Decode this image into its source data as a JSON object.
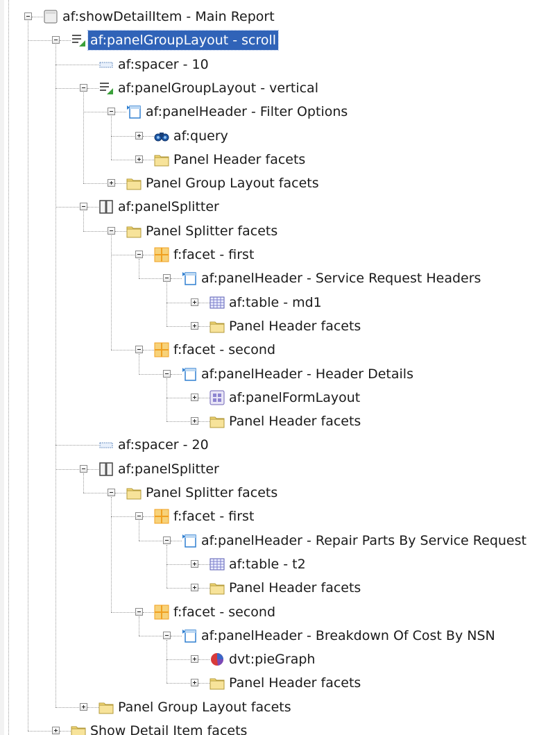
{
  "tree": {
    "nodes": [
      {
        "label": "af:showDetailItem - Main Report",
        "icon": "show-detail-item-icon",
        "depth": 0,
        "toggle": "minus"
      },
      {
        "label": "af:panelGroupLayout - scroll",
        "icon": "panel-group-layout-icon",
        "depth": 1,
        "toggle": "minus",
        "selected": true
      },
      {
        "label": "af:spacer - 10",
        "icon": "spacer-icon",
        "depth": 2,
        "toggle": "none"
      },
      {
        "label": "af:panelGroupLayout - vertical",
        "icon": "panel-group-layout-icon",
        "depth": 2,
        "toggle": "minus"
      },
      {
        "label": "af:panelHeader - Filter Options",
        "icon": "panel-header-icon",
        "depth": 3,
        "toggle": "minus"
      },
      {
        "label": "af:query",
        "icon": "binoculars-icon",
        "depth": 4,
        "toggle": "plus"
      },
      {
        "label": "Panel Header facets",
        "icon": "folder-icon",
        "depth": 4,
        "toggle": "plus"
      },
      {
        "label": "Panel Group Layout facets",
        "icon": "folder-icon",
        "depth": 3,
        "toggle": "plus"
      },
      {
        "label": "af:panelSplitter",
        "icon": "panel-splitter-icon",
        "depth": 2,
        "toggle": "minus"
      },
      {
        "label": "Panel Splitter facets",
        "icon": "folder-icon",
        "depth": 3,
        "toggle": "minus"
      },
      {
        "label": "f:facet - first",
        "icon": "facet-icon",
        "depth": 4,
        "toggle": "minus"
      },
      {
        "label": "af:panelHeader - Service Request Headers",
        "icon": "panel-header-icon",
        "depth": 5,
        "toggle": "minus"
      },
      {
        "label": "af:table - md1",
        "icon": "table-icon",
        "depth": 6,
        "toggle": "plus"
      },
      {
        "label": "Panel Header facets",
        "icon": "folder-icon",
        "depth": 6,
        "toggle": "plus"
      },
      {
        "label": "f:facet - second",
        "icon": "facet-icon",
        "depth": 4,
        "toggle": "minus"
      },
      {
        "label": "af:panelHeader - Header Details",
        "icon": "panel-header-icon",
        "depth": 5,
        "toggle": "minus"
      },
      {
        "label": "af:panelFormLayout",
        "icon": "panel-form-layout-icon",
        "depth": 6,
        "toggle": "plus"
      },
      {
        "label": "Panel Header facets",
        "icon": "folder-icon",
        "depth": 6,
        "toggle": "plus"
      },
      {
        "label": "af:spacer - 20",
        "icon": "spacer-icon",
        "depth": 2,
        "toggle": "none"
      },
      {
        "label": "af:panelSplitter",
        "icon": "panel-splitter-icon",
        "depth": 2,
        "toggle": "minus"
      },
      {
        "label": "Panel Splitter facets",
        "icon": "folder-icon",
        "depth": 3,
        "toggle": "minus"
      },
      {
        "label": "f:facet - first",
        "icon": "facet-icon",
        "depth": 4,
        "toggle": "minus"
      },
      {
        "label": "af:panelHeader - Repair Parts By Service Request",
        "icon": "panel-header-icon",
        "depth": 5,
        "toggle": "minus"
      },
      {
        "label": "af:table - t2",
        "icon": "table-icon",
        "depth": 6,
        "toggle": "plus"
      },
      {
        "label": "Panel Header facets",
        "icon": "folder-icon",
        "depth": 6,
        "toggle": "plus"
      },
      {
        "label": "f:facet - second",
        "icon": "facet-icon",
        "depth": 4,
        "toggle": "minus"
      },
      {
        "label": "af:panelHeader - Breakdown Of Cost By NSN",
        "icon": "panel-header-icon",
        "depth": 5,
        "toggle": "minus"
      },
      {
        "label": "dvt:pieGraph",
        "icon": "pie-graph-icon",
        "depth": 6,
        "toggle": "plus"
      },
      {
        "label": "Panel Header facets",
        "icon": "folder-icon",
        "depth": 6,
        "toggle": "plus"
      },
      {
        "label": "Panel Group Layout facets",
        "icon": "folder-icon",
        "depth": 2,
        "toggle": "plus"
      },
      {
        "label": "Show Detail Item facets",
        "icon": "folder-icon",
        "depth": 1,
        "toggle": "plus"
      }
    ]
  },
  "colors": {
    "selection": "#3063b8",
    "folder": "#f3d877",
    "facet": "#f0a020",
    "header_icon": "#2f7fd0"
  }
}
